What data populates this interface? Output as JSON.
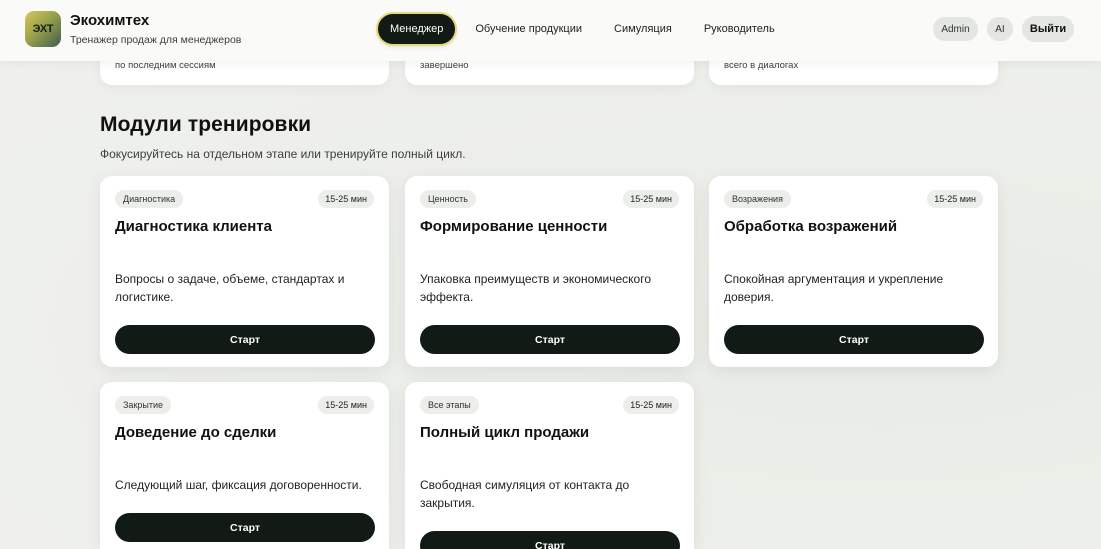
{
  "header": {
    "logo_text": "ЭХТ",
    "brand_title": "Экохимтех",
    "brand_subtitle": "Тренажер продаж для менеджеров",
    "nav": [
      {
        "label": "Менеджер",
        "active": true
      },
      {
        "label": "Обучение продукции",
        "active": false
      },
      {
        "label": "Симуляция",
        "active": false
      },
      {
        "label": "Руководитель",
        "active": false
      }
    ],
    "admin_label": "Admin",
    "ai_label": "AI",
    "logout_label": "Выйти"
  },
  "stats": [
    {
      "caption": "по последним сессиям"
    },
    {
      "caption": "завершено"
    },
    {
      "caption": "всего в диалогах"
    }
  ],
  "section": {
    "title": "Модули тренировки",
    "subtitle": "Фокусируйтесь на отдельном этапе или тренируйте полный цикл."
  },
  "modules": [
    {
      "tag": "Диагностика",
      "time": "15-25 мин",
      "title": "Диагностика клиента",
      "desc": "Вопросы о задаче, объеме, стандартах и логистике.",
      "button": "Старт"
    },
    {
      "tag": "Ценность",
      "time": "15-25 мин",
      "title": "Формирование ценности",
      "desc": "Упаковка преимуществ и экономического эффекта.",
      "button": "Старт"
    },
    {
      "tag": "Возражения",
      "time": "15-25 мин",
      "title": "Обработка возражений",
      "desc": "Спокойная аргументация и укрепление доверия.",
      "button": "Старт"
    },
    {
      "tag": "Закрытие",
      "time": "15-25 мин",
      "title": "Доведение до сделки",
      "desc": "Следующий шаг, фиксация договоренности.",
      "button": "Старт"
    },
    {
      "tag": "Все этапы",
      "time": "15-25 мин",
      "title": "Полный цикл продажи",
      "desc": "Свободная симуляция от контакта до закрытия.",
      "button": "Старт"
    }
  ]
}
